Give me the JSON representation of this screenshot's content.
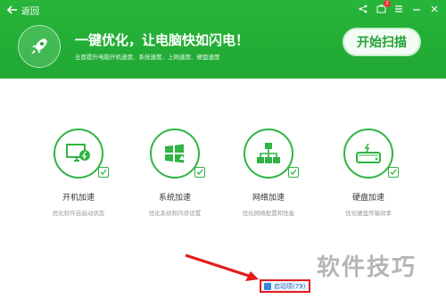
{
  "titlebar": {
    "back_label": "返回",
    "controls": [
      "share-icon",
      "skin-icon",
      "menu-icon",
      "minimize-icon",
      "close-icon"
    ],
    "skin_badge": "2"
  },
  "banner": {
    "headline": "一键优化，让电脑快如闪电！",
    "subline": "全面提升电脑开机速度、系统速度、上网速度、硬盘速度",
    "scan_button": "开始扫描"
  },
  "features": [
    {
      "icon": "monitor-boot-icon",
      "title": "开机加速",
      "desc": "优化软件自启动状态"
    },
    {
      "icon": "windows-system-icon",
      "title": "系统加速",
      "desc": "优化系统和内存设置"
    },
    {
      "icon": "network-icon",
      "title": "网络加速",
      "desc": "优化网络配置和性能"
    },
    {
      "icon": "disk-icon",
      "title": "硬盘加速",
      "desc": "优化硬盘传输效率"
    }
  ],
  "footer": {
    "boot_items_label": "启动项(79)"
  },
  "watermark": "软件技巧",
  "colors": {
    "brand_green": "#20a834",
    "highlight_red": "#e21c1c"
  }
}
